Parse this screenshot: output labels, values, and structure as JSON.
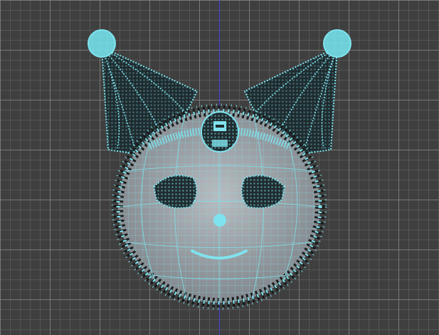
{
  "viewport": {
    "label": "",
    "colors": {
      "background": "#3f3f3f",
      "grid_minor": "#5a5a5a",
      "grid_major": "#6e6e6e",
      "axis": "#4a43d6",
      "selection": "#7fe3ee",
      "mesh_fill": "#9aa0a6",
      "dark_fill": "#1f2b2e"
    }
  },
  "model": {
    "name": "",
    "state": "selected",
    "display": "wireframe-on-shaded",
    "icons": [
      "sphere-mesh-icon",
      "ear-cone-icon",
      "pompom-sphere-icon"
    ]
  }
}
